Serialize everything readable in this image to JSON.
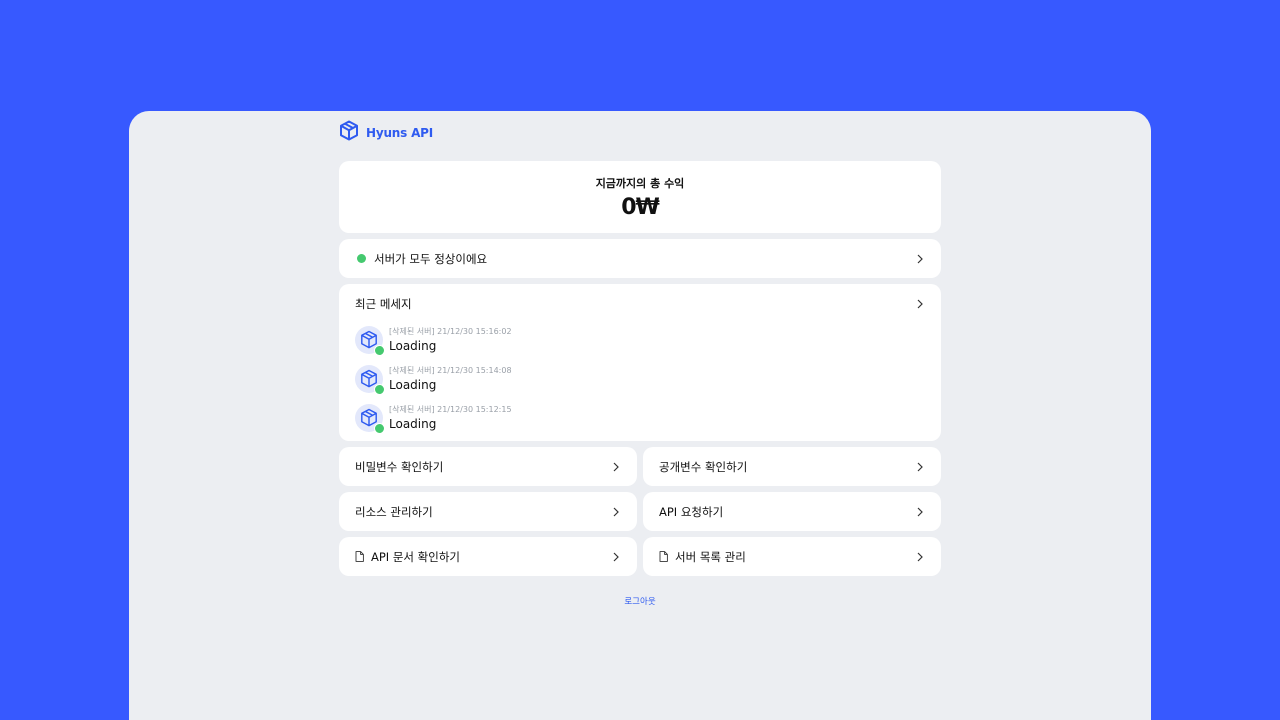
{
  "brand": {
    "name": "Hyuns API",
    "logo_icon": "cube-icon",
    "color": "#2f5bf0"
  },
  "earnings": {
    "label": "지금까지의 총 수익",
    "value": "0₩"
  },
  "server_status": {
    "text": "서버가 모두 정상이에요",
    "status_color": "#45c96f"
  },
  "recent_messages": {
    "title": "최근 메세지",
    "items": [
      {
        "meta": "[삭제된 서버] 21/12/30 15:16:02",
        "text": "Loading"
      },
      {
        "meta": "[삭제된 서버] 21/12/30 15:14:08",
        "text": "Loading"
      },
      {
        "meta": "[삭제된 서버] 21/12/30 15:12:15",
        "text": "Loading"
      }
    ]
  },
  "actions": {
    "secret_vars": "비밀변수 확인하기",
    "public_vars": "공개변수 확인하기",
    "resources": "리소스 관리하기",
    "api_request": "API 요청하기",
    "api_docs": "API 문서 확인하기",
    "server_list": "서버 목록 관리"
  },
  "logout": "로그아웃",
  "colors": {
    "background": "#3759ff",
    "panel": "#eceef2",
    "accent": "#2f5bf0"
  }
}
